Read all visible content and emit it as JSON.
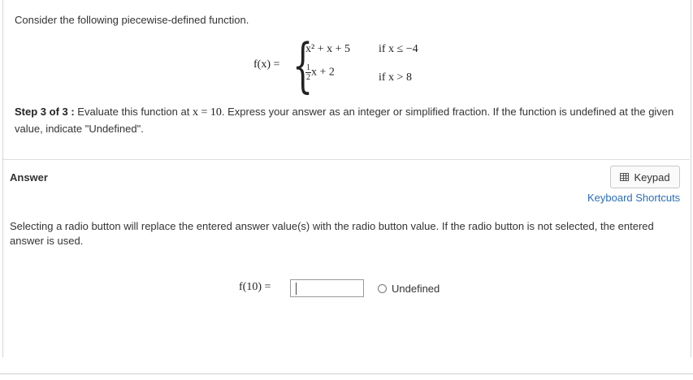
{
  "question": {
    "prompt": "Consider the following piecewise-defined function.",
    "function_label": "f(x) =",
    "case1_expr": "x² + x + 5",
    "case1_cond": "if x ≤ −4",
    "case2_frac_num": "1",
    "case2_frac_den": "2",
    "case2_expr_rest": "x + 2",
    "case2_cond": "if x > 8",
    "step_label": "Step 3 of 3 :",
    "step_text_before": " Evaluate this function at ",
    "step_math": "x = 10",
    "step_text_after": ". Express your answer as an integer or simplified fraction. If the function is undefined at the given value, indicate \"Undefined\"."
  },
  "answer": {
    "heading": "Answer",
    "keypad_label": "Keypad",
    "shortcuts_label": "Keyboard Shortcuts",
    "radio_note": "Selecting a radio button will replace the entered answer value(s) with the radio button value. If the radio button is not selected, the entered answer is used.",
    "input_label": "f(10) =",
    "input_value": "",
    "radio_label": "Undefined",
    "keypad_icon": "calculator-icon"
  }
}
